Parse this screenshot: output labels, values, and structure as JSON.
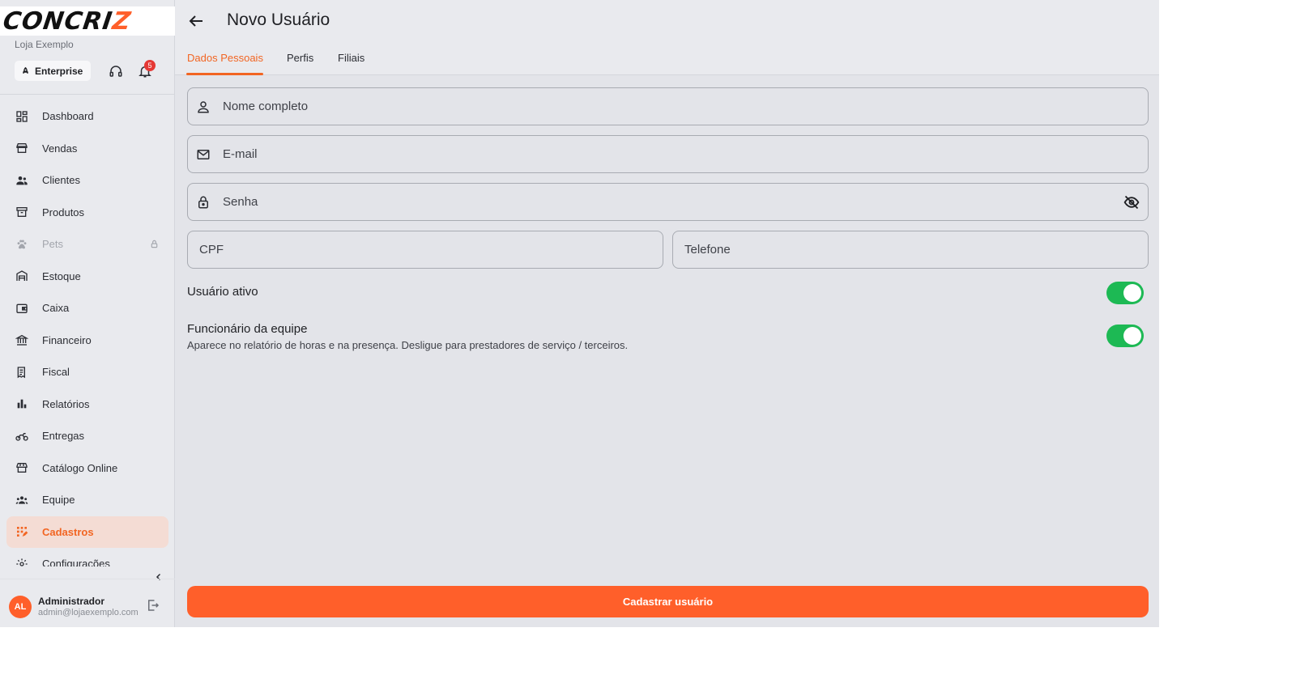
{
  "brand": {
    "logo_main": "CONCRI",
    "logo_accent": "Z",
    "store_name": "Loja Exemplo",
    "plan": "Enterprise",
    "notifications": "5",
    "accent_color": "#ff5f2a"
  },
  "sidebar": {
    "items": [
      {
        "label": "Dashboard",
        "icon": "dashboard-icon"
      },
      {
        "label": "Vendas",
        "icon": "store-icon"
      },
      {
        "label": "Clientes",
        "icon": "people-icon"
      },
      {
        "label": "Produtos",
        "icon": "archive-icon"
      },
      {
        "label": "Pets",
        "icon": "paw-icon",
        "locked": true
      },
      {
        "label": "Estoque",
        "icon": "warehouse-icon"
      },
      {
        "label": "Caixa",
        "icon": "wallet-icon"
      },
      {
        "label": "Financeiro",
        "icon": "bank-icon"
      },
      {
        "label": "Fiscal",
        "icon": "receipt-icon"
      },
      {
        "label": "Relatórios",
        "icon": "bar-chart-icon"
      },
      {
        "label": "Entregas",
        "icon": "motorcycle-icon"
      },
      {
        "label": "Catálogo Online",
        "icon": "storefront-icon"
      },
      {
        "label": "Equipe",
        "icon": "groups-icon"
      },
      {
        "label": "Cadastros",
        "icon": "app-registration-icon",
        "active": true
      },
      {
        "label": "Configurações",
        "icon": "settings-icon"
      }
    ]
  },
  "user": {
    "initials": "AL",
    "name": "Administrador",
    "email": "admin@lojaexemplo.com"
  },
  "header": {
    "title": "Novo Usuário"
  },
  "tabs": [
    {
      "label": "Dados Pessoais",
      "active": true
    },
    {
      "label": "Perfis"
    },
    {
      "label": "Filiais"
    }
  ],
  "form": {
    "name_placeholder": "Nome completo",
    "email_placeholder": "E-mail",
    "password_placeholder": "Senha",
    "cpf_placeholder": "CPF",
    "phone_placeholder": "Telefone",
    "active_label": "Usuário ativo",
    "active_value": true,
    "staff_label": "Funcionário da equipe",
    "staff_desc": "Aparece no relatório de horas e na presença. Desligue para prestadores de serviço / terceiros.",
    "staff_value": true,
    "submit_label": "Cadastrar usuário"
  }
}
